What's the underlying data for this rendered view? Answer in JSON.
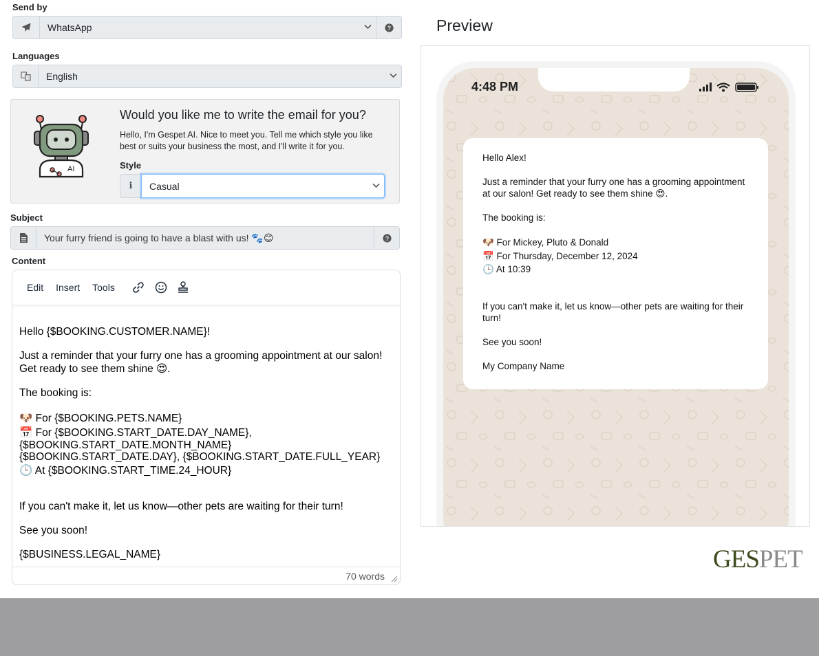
{
  "send_by": {
    "label": "Send by",
    "value": "WhatsApp"
  },
  "languages": {
    "label": "Languages",
    "value": "English"
  },
  "ai": {
    "title": "Would you like me to write the email for you?",
    "intro": "Hello, I'm Gespet AI. Nice to meet you. Tell me which style you like best or suits your business the most, and I'll write it for you.",
    "style_label": "Style",
    "style_value": "Casual",
    "robot_badge": "AI"
  },
  "subject": {
    "label": "Subject",
    "value": "Your furry friend is going to have a blast with us! 🐾😊"
  },
  "content": {
    "label": "Content",
    "menus": [
      "Edit",
      "Insert",
      "Tools"
    ],
    "greeting": "Hello {$BOOKING.CUSTOMER.NAME}!",
    "reminder": "Just a reminder that your furry one has a grooming appointment at our salon! Get ready to see them shine 😍.",
    "booking_intro": "The booking is:",
    "pets": "🐶 For {$BOOKING.PETS.NAME}",
    "date_line1": "📅 For {$BOOKING.START_DATE.DAY_NAME},",
    "date_line2": "{$BOOKING.START_DATE.MONTH_NAME}",
    "date_line3": "{$BOOKING.START_DATE.DAY}, {$BOOKING.START_DATE.FULL_YEAR}",
    "time": "🕒 At {$BOOKING.START_TIME.24_HOUR}",
    "cant_make": "If you can't make it, let us know—other pets are waiting for their turn!",
    "see_you": "See you soon!",
    "signature": "{$BUSINESS.LEGAL_NAME}",
    "word_count": "70 words"
  },
  "preview": {
    "title": "Preview",
    "time": "4:48 PM",
    "greeting": "Hello Alex!",
    "reminder": "Just a reminder that your furry one has a grooming appointment at our salon! Get ready to see them shine 😍.",
    "booking_intro": "The booking is:",
    "pets": "🐶 For Mickey, Pluto & Donald",
    "date": "📅 For Thursday, December 12, 2024",
    "time_line": "🕒 At 10:39",
    "cant_make": "If you can't make it, let us know—other pets are waiting for their turn!",
    "see_you": "See you soon!",
    "signature": "My Company Name"
  },
  "logo": {
    "part1": "GES",
    "part2": "PET",
    "color1": "#3d4a1c",
    "color2": "#8a8a8a"
  }
}
